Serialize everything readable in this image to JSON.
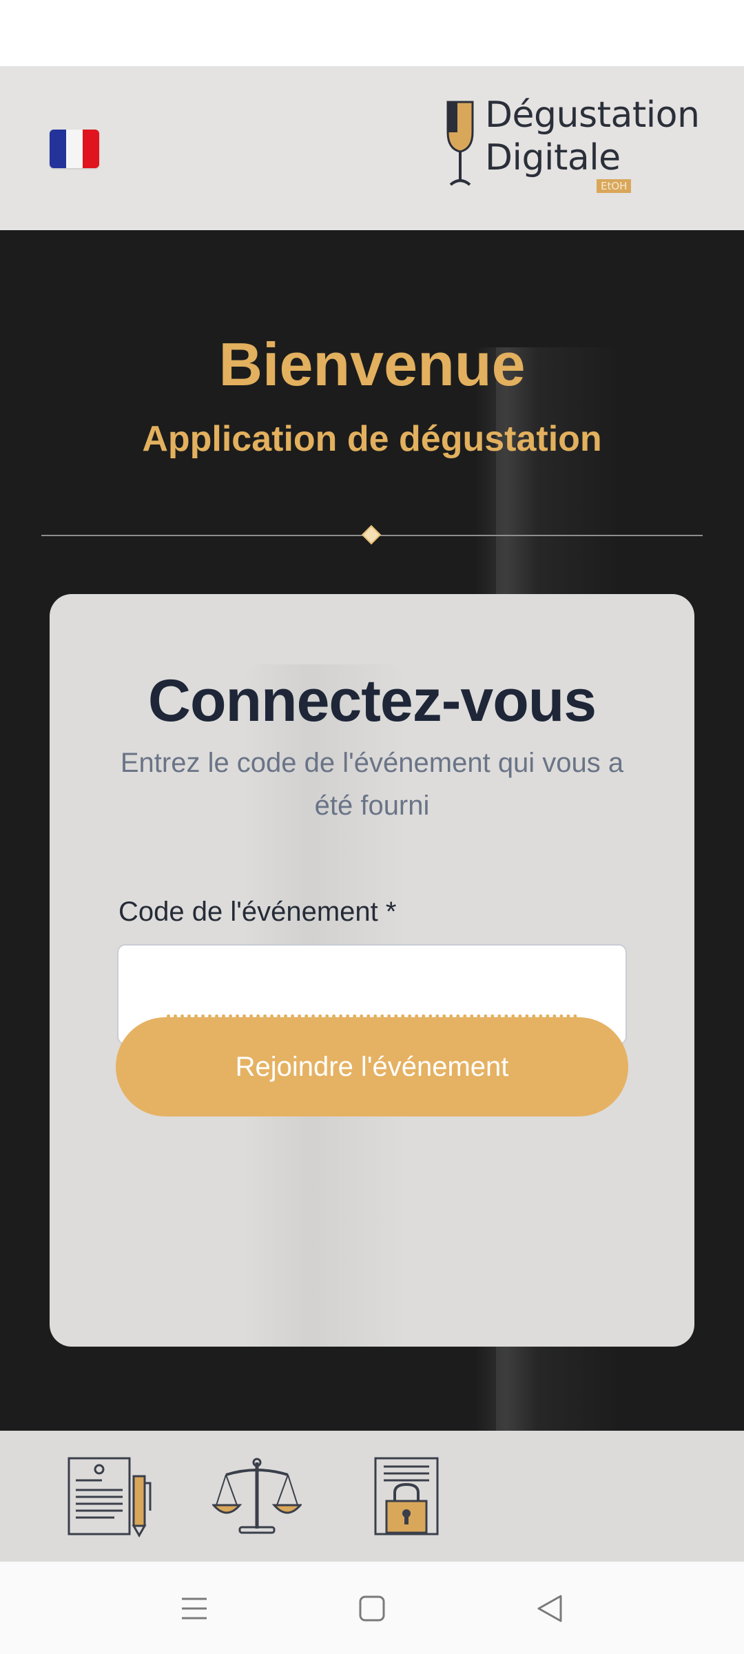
{
  "header": {
    "flag_icon": "france-flag-icon",
    "logo": {
      "line1": "Dégustation",
      "line2": "Digitale",
      "badge": "EtOH"
    }
  },
  "hero": {
    "title": "Bienvenue",
    "subtitle": "Application de dégustation"
  },
  "login_card": {
    "title": "Connectez-vous",
    "description": "Entrez le code de l'événement qui vous a été fourni",
    "code_label": "Code de l'événement *",
    "code_value": "",
    "join_button_label": "Rejoindre l'événement"
  },
  "footer": {
    "icons": [
      "legal-notice-icon",
      "scales-of-justice-icon",
      "privacy-lock-icon"
    ]
  },
  "system_nav": {
    "icons": [
      "recents-icon",
      "home-icon",
      "back-icon"
    ]
  },
  "colors": {
    "accent": "#e2b05e",
    "button": "#e5b263",
    "header_bg": "#e4e3e1",
    "hero_bg": "#1c1c1c",
    "card_bg": "#dddcda",
    "title_text": "#1e2638"
  }
}
